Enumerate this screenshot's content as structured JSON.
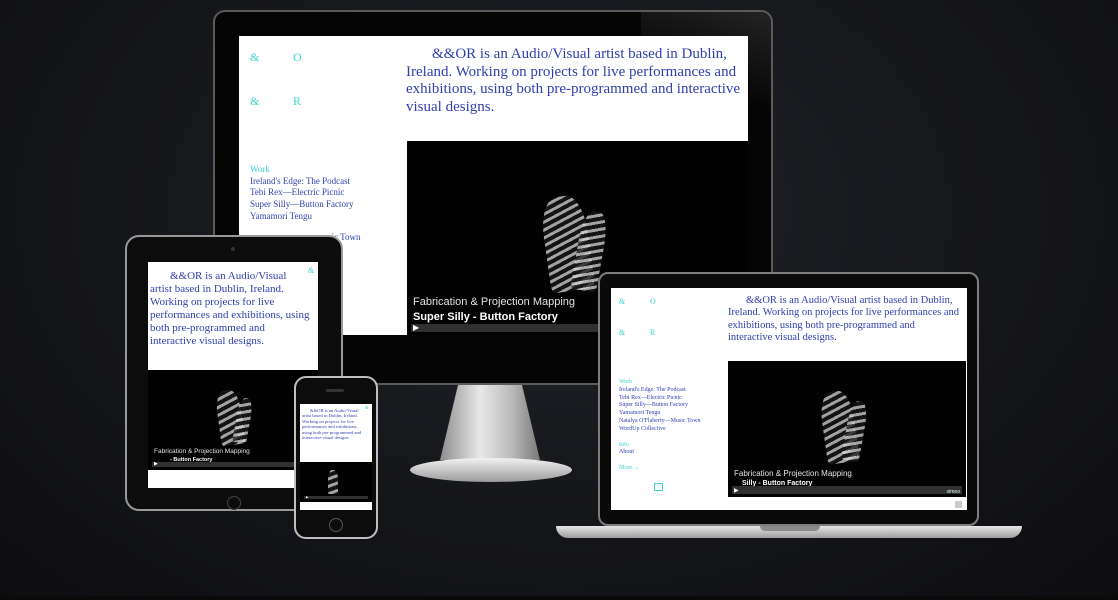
{
  "site": {
    "logo_marks": [
      "&",
      "O",
      "&",
      "R"
    ],
    "intro_text": "&&OR is an Audio/Visual artist based in Dublin, Ireland. Working on projects for live performances and exhibitions, using both pre-programmed and interactive visual designs.",
    "nav_heading_work": "Work",
    "work_items": [
      "Ireland's Edge: The Podcast",
      "Tebi Rex—Electric Picnic",
      "Super Silly—Button Factory",
      "Yamamori Tengu",
      "Natalya O'Flaherty—Music Town",
      "WordUp Collective"
    ],
    "nav_heading_info": "Info",
    "info_items": [
      "About"
    ],
    "more_label": "More →",
    "video_title": "Fabrication & Projection Mapping",
    "video_subtitle": "Super Silly - Button Factory",
    "video_brand": "vimeo",
    "play_icon": "play-icon",
    "colors": {
      "accent": "#39d3cc",
      "text": "#2f3fb0",
      "page_bg": "#141518",
      "screen_bg": "#ffffff"
    }
  },
  "desktop": {
    "work_items_visible": [
      "Ireland's Edge: The Podcast",
      "Tebi Rex—Electric Picnic",
      "Super Silly—Button Factory",
      "Yamamori Tengu"
    ],
    "partial_item": "asic Town"
  },
  "laptop": {
    "video_subtitle_partial": "Silly - Button Factory"
  },
  "tablet": {
    "video_subtitle_partial": "- Button Factory"
  }
}
